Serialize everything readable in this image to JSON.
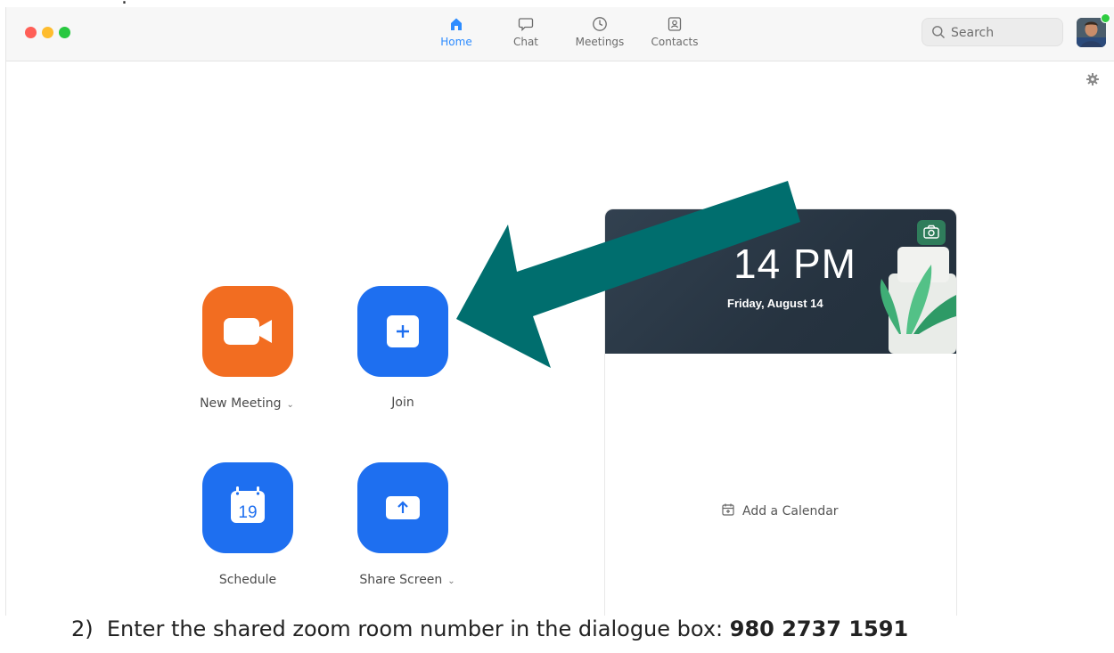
{
  "window": {
    "tabs": [
      {
        "label": "Home",
        "icon": "home-icon",
        "active": true
      },
      {
        "label": "Chat",
        "icon": "chat-bubble-icon",
        "active": false
      },
      {
        "label": "Meetings",
        "icon": "clock-icon",
        "active": false
      },
      {
        "label": "Contacts",
        "icon": "contact-card-icon",
        "active": false
      }
    ],
    "search": {
      "placeholder": "Search"
    }
  },
  "actions": {
    "new_meeting": "New Meeting",
    "join": "Join",
    "schedule": "Schedule",
    "calendar_day": "19",
    "share_screen": "Share Screen"
  },
  "calendar_panel": {
    "time_visible": "14 PM",
    "date": "Friday, August 14",
    "add_calendar": "Add a Calendar"
  },
  "instruction": {
    "prefix": "2)  Enter the shared zoom room number in the dialogue box: ",
    "room_number": "980 2737 1591"
  },
  "colors": {
    "accent_blue": "#1e6ff0",
    "new_meeting_orange": "#f26d21",
    "arrow_teal": "#006e6e",
    "active_tab": "#2d8cff"
  }
}
